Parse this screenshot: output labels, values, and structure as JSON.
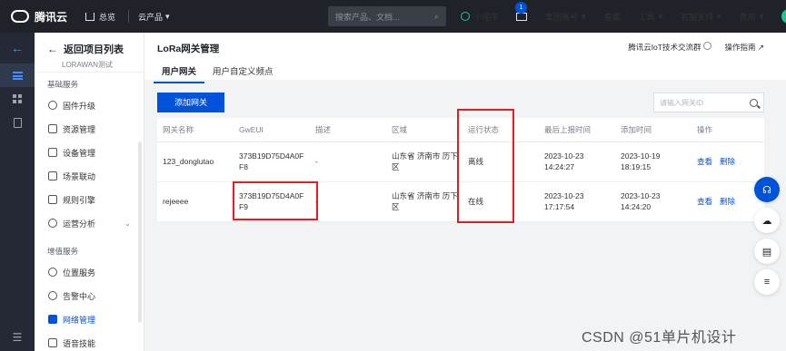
{
  "topbar": {
    "brand": "腾讯云",
    "home": "总览",
    "products": "云产品",
    "search_placeholder": "搜索产品、文档...",
    "mini_program": "小程序",
    "mail_badge": "1",
    "group_account": "集团账号",
    "filing": "备案",
    "tools": "工具",
    "support": "客服支持",
    "billing": "费用",
    "avatar": "1"
  },
  "sidebar": {
    "back_label": "返回项目列表",
    "project": "LORAWAN测试",
    "groups": [
      {
        "title": "基础服务",
        "items": [
          {
            "label": "固件升级",
            "icon": "firmware-icon"
          },
          {
            "label": "资源管理",
            "icon": "resource-icon"
          },
          {
            "label": "设备管理",
            "icon": "device-icon"
          },
          {
            "label": "场景联动",
            "icon": "scene-icon"
          },
          {
            "label": "规则引擎",
            "icon": "rule-icon"
          },
          {
            "label": "运营分析",
            "icon": "analysis-icon"
          }
        ]
      },
      {
        "title": "增值服务",
        "items": [
          {
            "label": "位置服务",
            "icon": "location-icon"
          },
          {
            "label": "告警中心",
            "icon": "alarm-icon"
          },
          {
            "label": "网络管理",
            "icon": "network-icon"
          },
          {
            "label": "语音技能",
            "icon": "voice-icon"
          }
        ]
      }
    ]
  },
  "main": {
    "title": "LoRa网关管理",
    "links": {
      "community": "腾讯云IoT技术交流群",
      "guide": "操作指南"
    },
    "tabs": [
      "用户网关",
      "用户自定义频点"
    ],
    "add_button": "添加网关",
    "search_placeholder": "请输入网关ID",
    "columns": [
      "网关名称",
      "GwEUI",
      "描述",
      "区域",
      "运行状态",
      "最后上报时间",
      "添加时间",
      "操作"
    ],
    "rows": [
      {
        "name": "123_donglutao",
        "gweui": "373B19D75D4A0F F8",
        "desc": "-",
        "region": "山东省 济南市 历下 区",
        "status": "离线",
        "last_report": "2023-10-23 14:24:27",
        "added": "2023-10-19 18:19:15",
        "view": "查看",
        "delete": "删除"
      },
      {
        "name": "rejeeee",
        "gweui": "373B19D75D4A0F F9",
        "desc": "-",
        "region": "山东省 济南市 历下 区",
        "status": "在线",
        "last_report": "2023-10-23 17:17:54",
        "added": "2023-10-23 14:24:20",
        "view": "查看",
        "delete": "删除"
      }
    ]
  },
  "watermark": "CSDN @51单片机设计",
  "colors": {
    "accent": "#0052d9",
    "highlight": "#e51c23",
    "topbar": "#1f2329"
  }
}
